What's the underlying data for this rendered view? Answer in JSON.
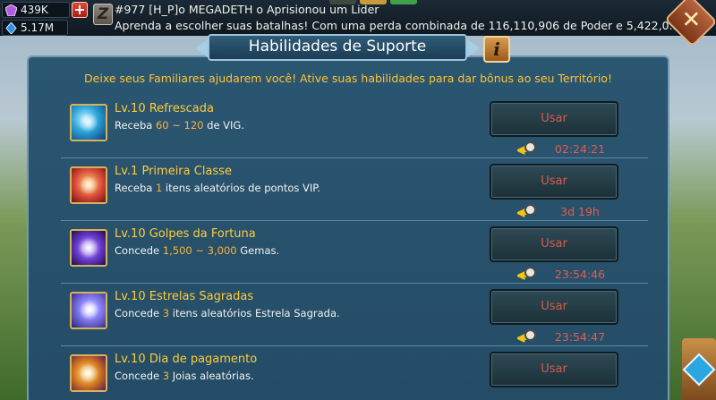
{
  "resources": {
    "gems": "439K",
    "power": "5.17M"
  },
  "news": {
    "line1": "#977 [H_P]o MEGADETH o Aprisionou um Lider",
    "line2": "Aprenda a escolher suas batalhas!  Com uma perda combinada de 116,110,906 de Poder e 5,422,0..."
  },
  "buttons": {
    "plus": "+",
    "close": "✕",
    "info": "i"
  },
  "window": {
    "title": "Habilidades de Suporte",
    "subtitle": "Deixe seus Familiares ajudarem você!  Ative suas habilidades para dar bônus ao seu Território!"
  },
  "skills": [
    {
      "name": "Lv.10 Refrescada",
      "desc_pre": "Receba ",
      "desc_hl": "60 ~ 120",
      "desc_post": " de VIG.",
      "button": "Usar",
      "timer": "02:24:21",
      "icon": "refresh-icon",
      "color": "#2aa3d8"
    },
    {
      "name": "Lv.1 Primeira Classe",
      "desc_pre": "Receba ",
      "desc_hl": "1",
      "desc_post": " itens aleatórios de pontos VIP.",
      "button": "Usar",
      "timer": "3d 19h",
      "icon": "gift-icon",
      "color": "#d8483a"
    },
    {
      "name": "Lv.10 Golpes da Fortuna",
      "desc_pre": "Concede ",
      "desc_hl": "1,500 ~ 3,000",
      "desc_post": " Gemas.",
      "button": "Usar",
      "timer": "23:54:46",
      "icon": "claw-icon",
      "color": "#6a3bd0"
    },
    {
      "name": "Lv.10 Estrelas Sagradas",
      "desc_pre": "Concede ",
      "desc_hl": "3",
      "desc_post": " itens aleatórios Estrela Sagrada.",
      "button": "Usar",
      "timer": "23:54:47",
      "icon": "star-icon",
      "color": "#3a32a8"
    },
    {
      "name": "Lv.10 Dia de pagamento",
      "desc_pre": "Concede ",
      "desc_hl": "3",
      "desc_post": " Joias aleatórias.",
      "button": "Usar",
      "timer": "",
      "icon": "payday-icon",
      "color": "#d67a1c"
    }
  ]
}
